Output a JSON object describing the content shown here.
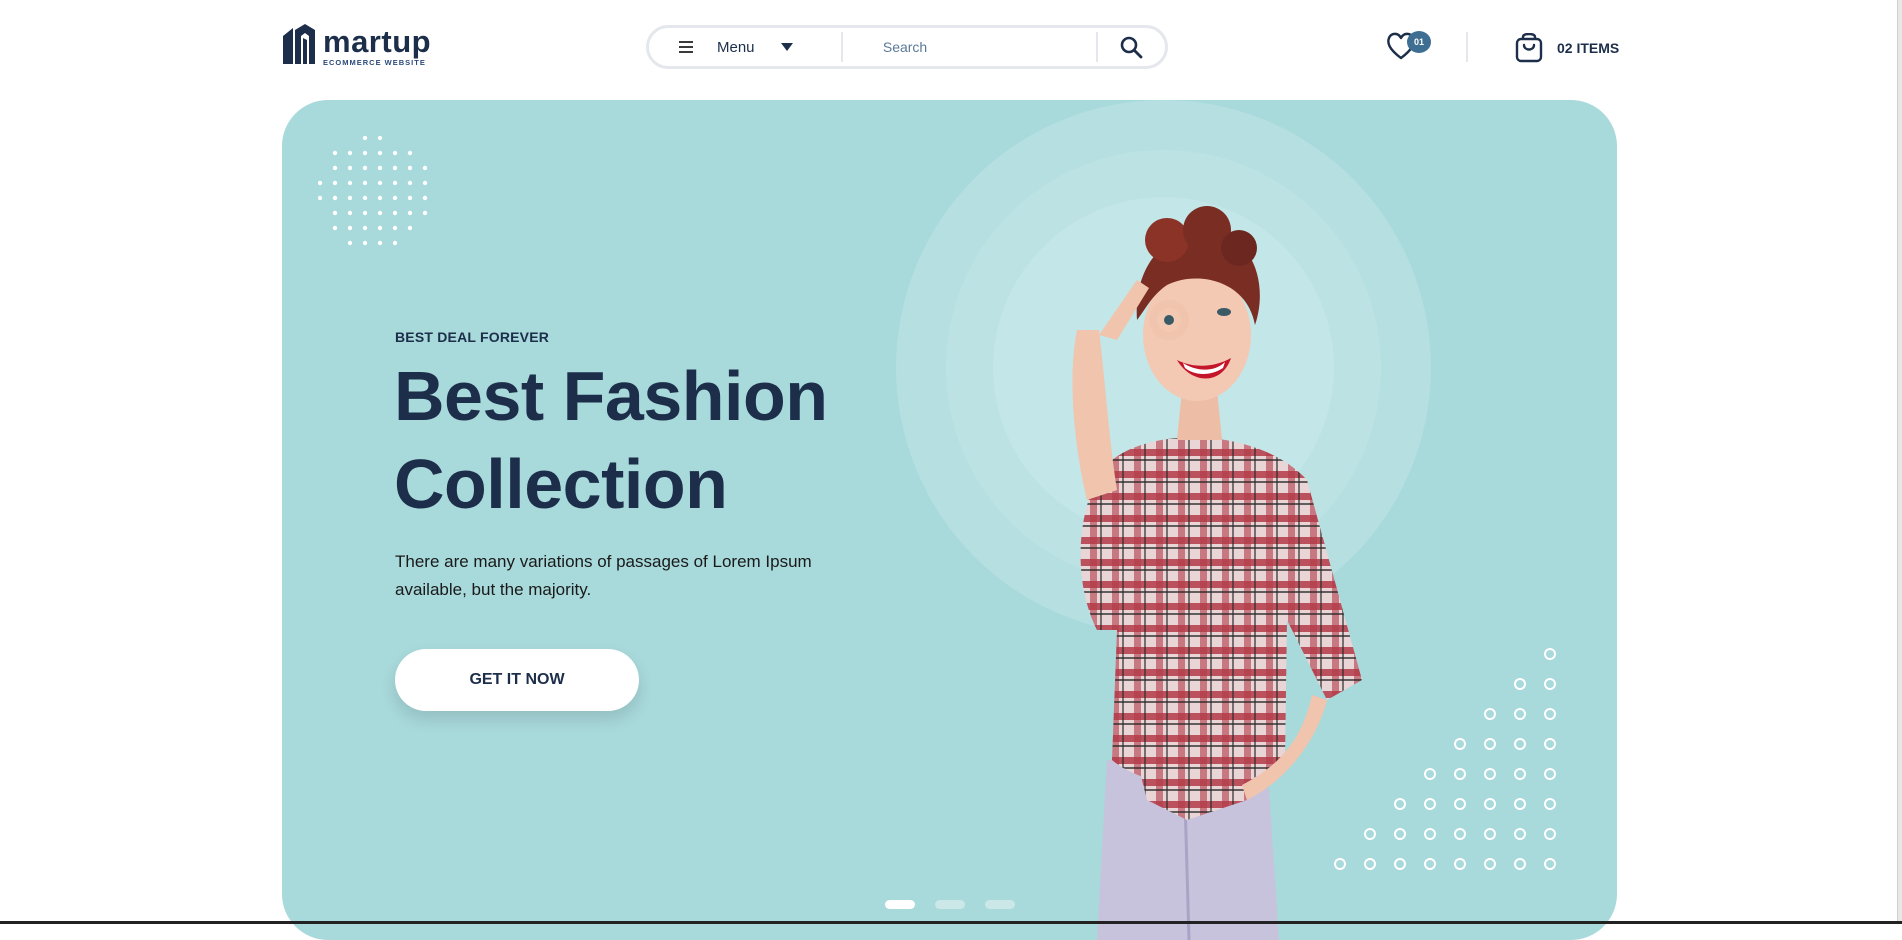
{
  "brand": {
    "name": "martup",
    "tagline": "ECOMMERCE WEBSITE",
    "logo_icon": "building-m-logo"
  },
  "header": {
    "menu_label": "Menu",
    "menu_icon": "hamburger-icon",
    "search_placeholder": "Search",
    "search_icon": "magnifier-icon",
    "wishlist_icon": "heart-icon",
    "wishlist_count": "01",
    "cart_icon": "shopping-bag-icon",
    "cart_label": "02 ITEMS"
  },
  "hero": {
    "eyebrow": "BEST DEAL FOREVER",
    "title_line1": "Best Fashion",
    "title_line2": "Collection",
    "description": "There are many variations of passages of Lorem Ipsum available, but the majority.",
    "cta_label": "GET IT NOW",
    "slides": 3,
    "active_slide": 1
  },
  "colors": {
    "hero_bg": "#a8d9db",
    "text_dark": "#1c2e4a",
    "badge": "#3f6e93",
    "button_bg": "#ffffff"
  }
}
